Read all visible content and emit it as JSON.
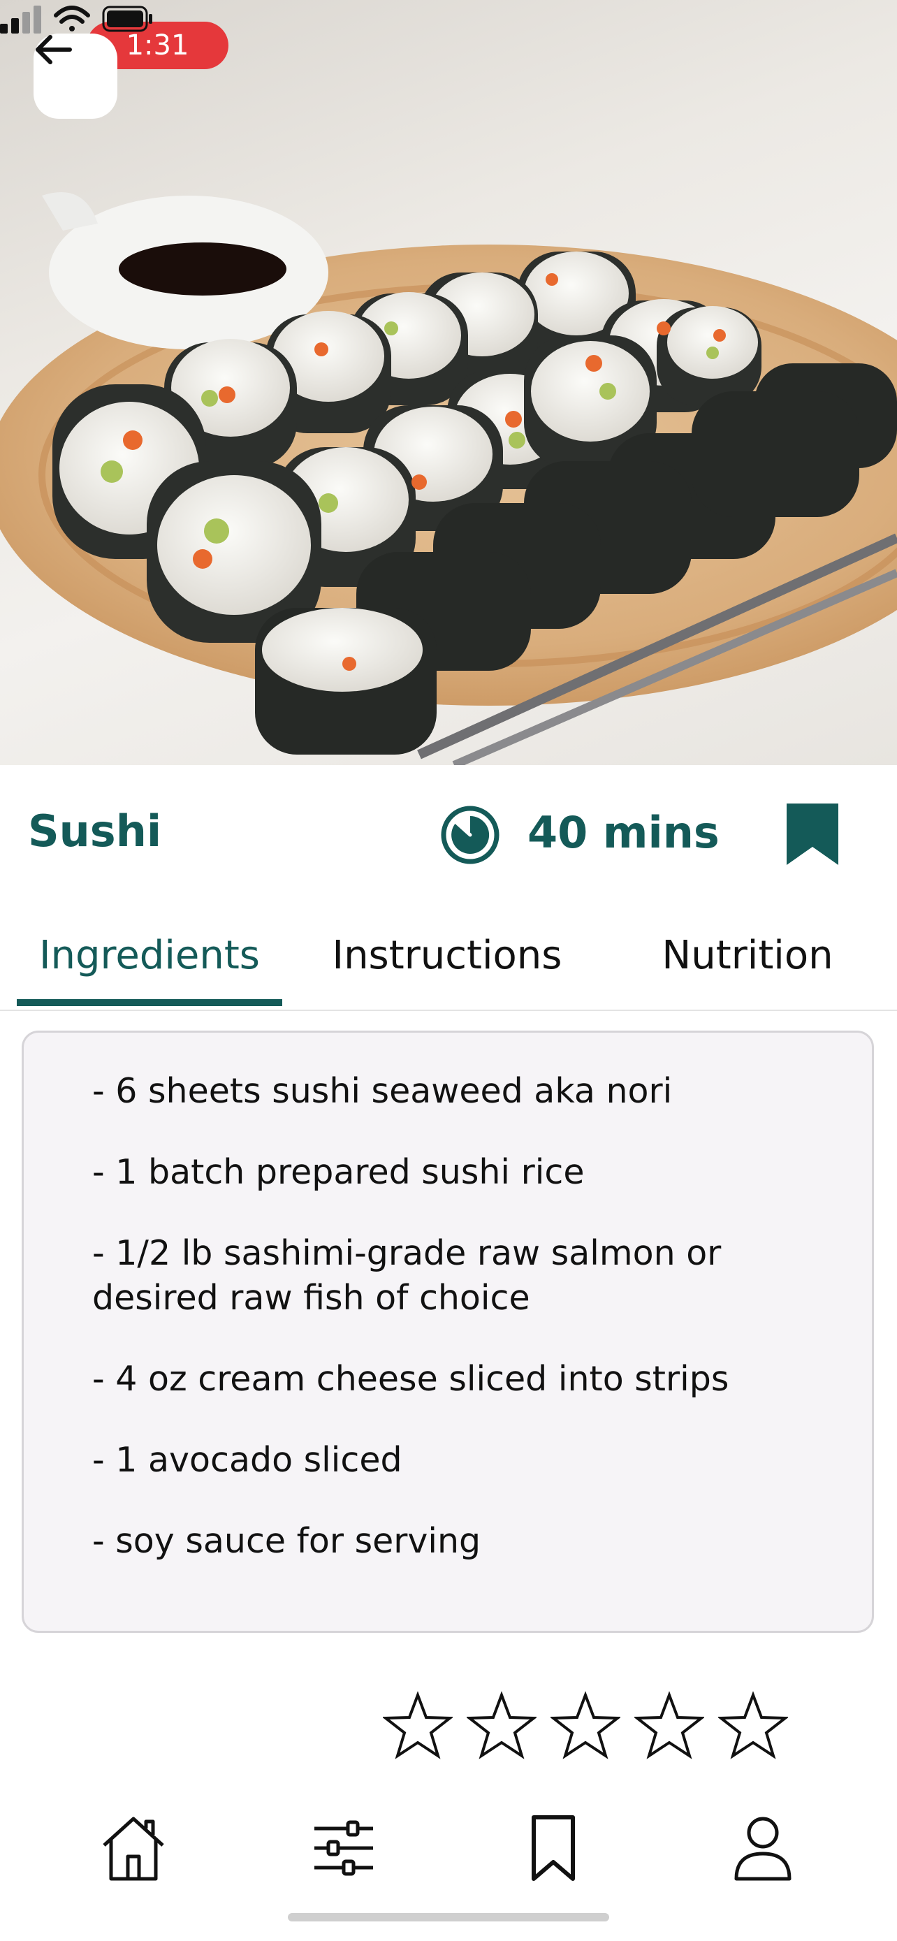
{
  "status_bar": {
    "time": "1:31"
  },
  "recipe": {
    "title": "Sushi",
    "time": "40 mins"
  },
  "tabs": [
    {
      "label": "Ingredients",
      "active": true
    },
    {
      "label": "Instructions",
      "active": false
    },
    {
      "label": "Nutrition",
      "active": false
    }
  ],
  "ingredients": [
    "- 6 sheets sushi seaweed aka nori",
    "- 1 batch prepared sushi rice",
    "- 1/2 lb sashimi-grade raw salmon or desired raw fish of choice",
    "- 4 oz cream cheese sliced into strips",
    "- 1 avocado sliced",
    "- soy sauce for serving"
  ],
  "rating": {
    "value": 0,
    "max": 5
  },
  "nav": [
    {
      "icon": "home-icon"
    },
    {
      "icon": "sliders-icon"
    },
    {
      "icon": "bookmark-icon"
    },
    {
      "icon": "profile-icon"
    }
  ],
  "colors": {
    "accent": "#145a58",
    "status_pill": "#e5383b",
    "card_bg": "#f6f4f7"
  }
}
